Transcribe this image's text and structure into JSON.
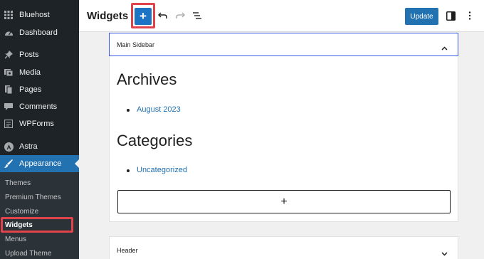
{
  "sidebar": {
    "items": [
      {
        "label": "Bluehost",
        "icon": "grid-icon"
      },
      {
        "label": "Dashboard",
        "icon": "dashboard-icon"
      },
      {
        "label": "Posts",
        "icon": "pin-icon"
      },
      {
        "label": "Media",
        "icon": "media-icon"
      },
      {
        "label": "Pages",
        "icon": "pages-icon"
      },
      {
        "label": "Comments",
        "icon": "comment-icon"
      },
      {
        "label": "WPForms",
        "icon": "forms-icon"
      },
      {
        "label": "Astra",
        "icon": "astra-icon"
      },
      {
        "label": "Appearance",
        "icon": "brush-icon"
      }
    ],
    "submenu": [
      "Themes",
      "Premium Themes",
      "Customize",
      "Widgets",
      "Menus",
      "Upload Theme"
    ],
    "current_sub": "Widgets"
  },
  "topbar": {
    "title": "Widgets",
    "add_label": "+",
    "update_label": "Update"
  },
  "main": {
    "area_title": "Main Sidebar",
    "blocks": [
      {
        "heading": "Archives",
        "items": [
          "August 2023"
        ]
      },
      {
        "heading": "Categories",
        "items": [
          "Uncategorized"
        ]
      }
    ],
    "appender_label": "+",
    "second_area_title": "Header"
  },
  "colors": {
    "sidebar_bg": "#1d2327",
    "accent": "#2271b1",
    "highlight": "#e0434b"
  }
}
